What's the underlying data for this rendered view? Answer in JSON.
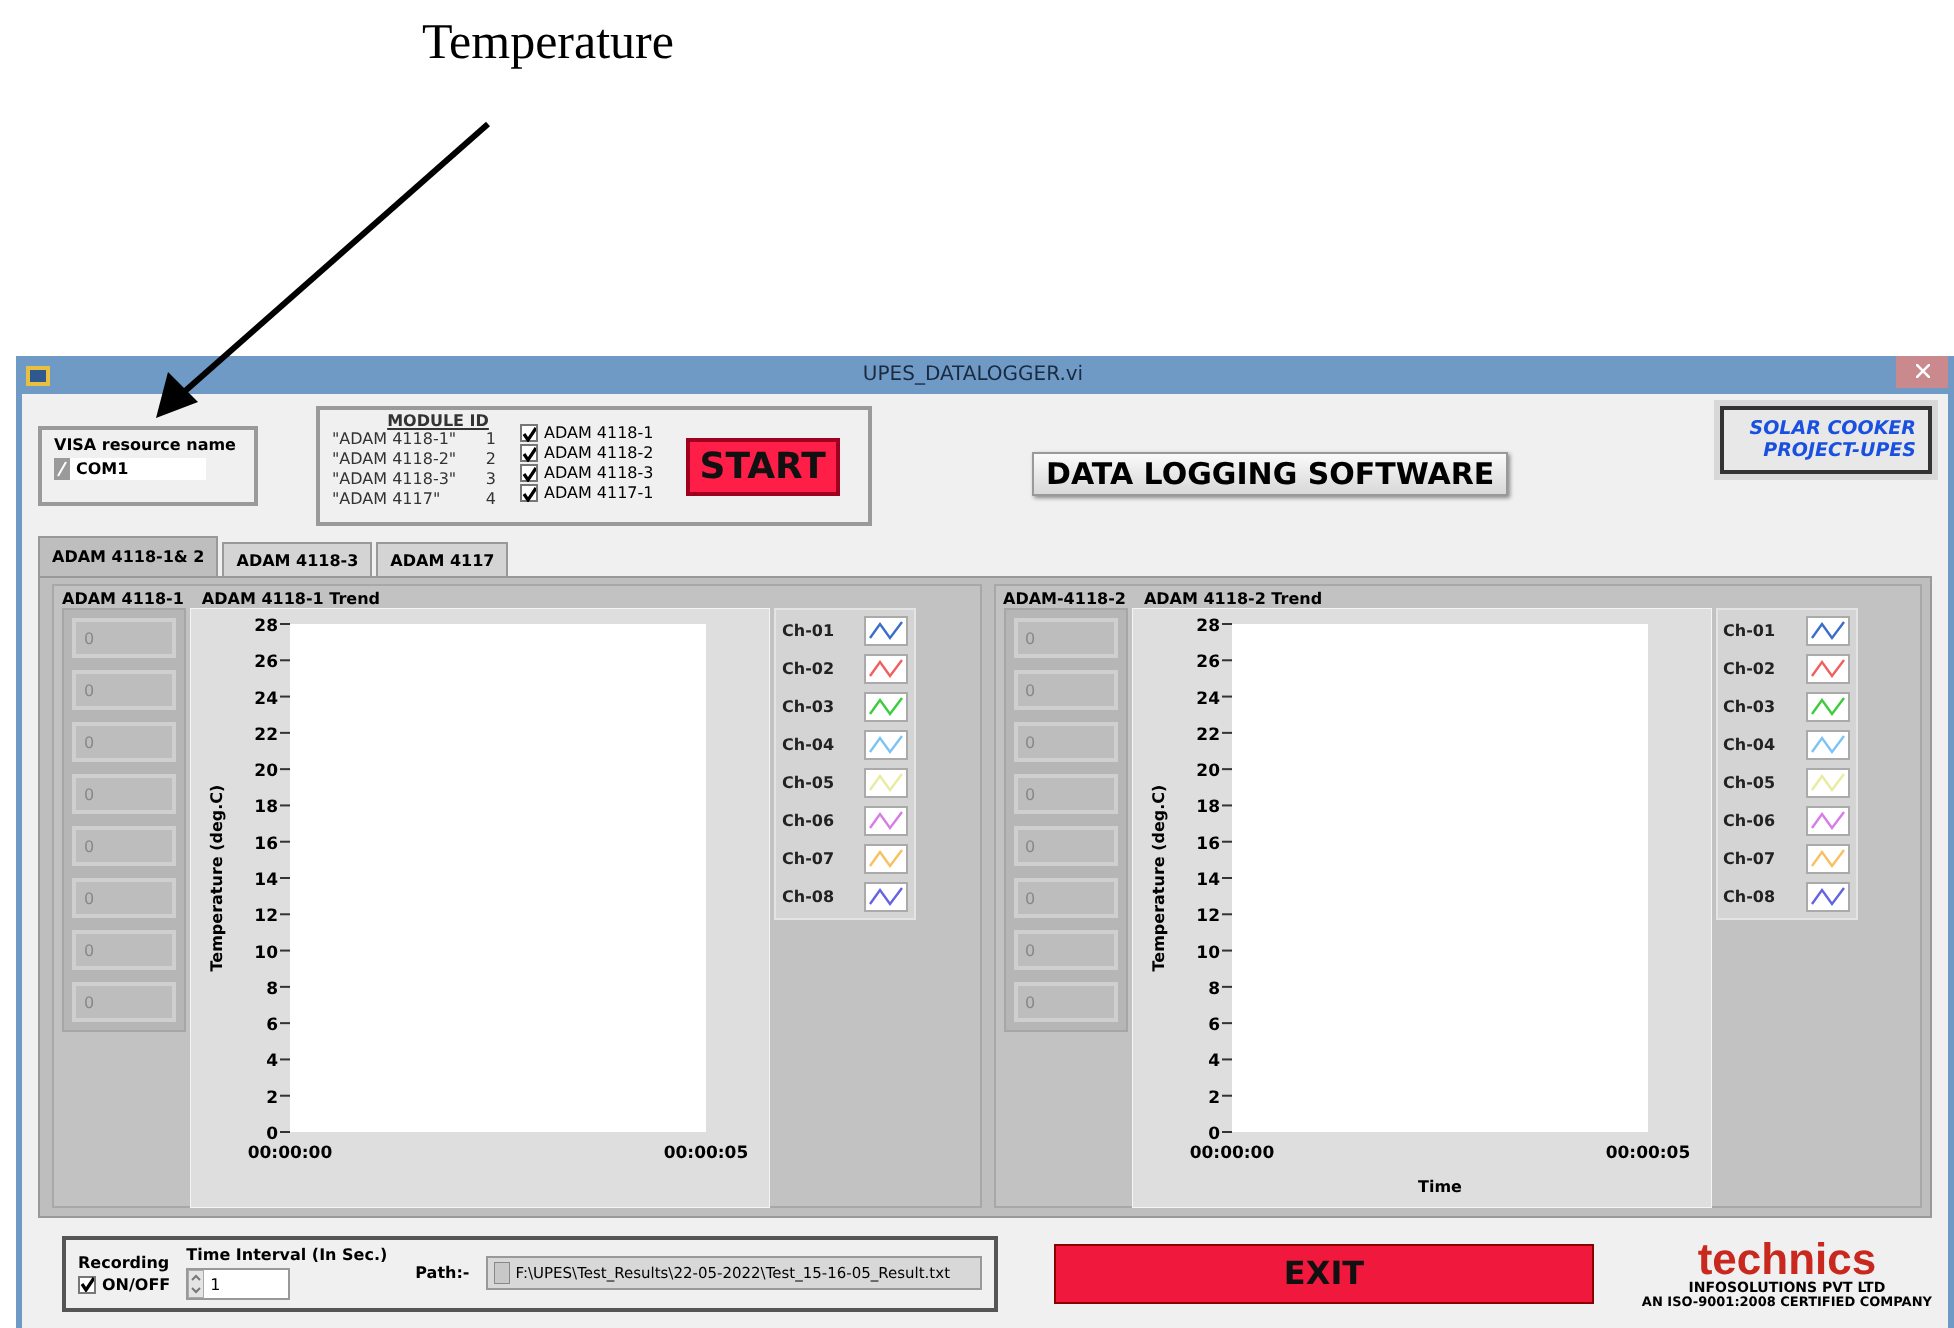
{
  "annotation": {
    "label": "Temperature"
  },
  "window": {
    "title": "UPES_DATALOGGER.vi"
  },
  "visa": {
    "label": "VISA resource name",
    "value": "COM1"
  },
  "module_id": {
    "title": "MODULE ID",
    "rows": [
      {
        "name": "\"ADAM 4118-1\"",
        "number": "1"
      },
      {
        "name": "\"ADAM 4118-2\"",
        "number": "2"
      },
      {
        "name": "\"ADAM 4118-3\"",
        "number": "3"
      },
      {
        "name": "\"ADAM 4117\"",
        "number": "4"
      }
    ],
    "checkboxes": [
      {
        "label": "ADAM 4118-1",
        "checked": true
      },
      {
        "label": "ADAM 4118-2",
        "checked": true
      },
      {
        "label": "ADAM 4118-3",
        "checked": true
      },
      {
        "label": "ADAM 4117-1",
        "checked": true
      }
    ]
  },
  "start_button": "START",
  "banner": "DATA LOGGING SOFTWARE",
  "project": [
    "SOLAR COOKER",
    "PROJECT-UPES"
  ],
  "tabs": [
    {
      "label": "ADAM 4118-1& 2",
      "selected": true
    },
    {
      "label": "ADAM  4118-3",
      "selected": false
    },
    {
      "label": "ADAM  4117",
      "selected": false
    }
  ],
  "panels": [
    {
      "indicator_label": "ADAM 4118-1",
      "trend_title": "ADAM 4118-1 Trend",
      "readings": [
        "0",
        "0",
        "0",
        "0",
        "0",
        "0",
        "0",
        "0"
      ],
      "y_label": "Temperature (deg.C)",
      "y_ticks": [
        "28",
        "26",
        "24",
        "22",
        "20",
        "18",
        "16",
        "14",
        "12",
        "10",
        "8",
        "6",
        "4",
        "2",
        "0"
      ],
      "x_ticks": [
        "00:00:00",
        "00:00:05"
      ],
      "legend": [
        {
          "name": "Ch-01",
          "color": "#3a6ec8"
        },
        {
          "name": "Ch-02",
          "color": "#f06060"
        },
        {
          "name": "Ch-03",
          "color": "#3ccc3c"
        },
        {
          "name": "Ch-04",
          "color": "#7cc4f4"
        },
        {
          "name": "Ch-05",
          "color": "#e8eca0"
        },
        {
          "name": "Ch-06",
          "color": "#d87ce8"
        },
        {
          "name": "Ch-07",
          "color": "#f8c060"
        },
        {
          "name": "Ch-08",
          "color": "#6464e0"
        }
      ]
    },
    {
      "indicator_label": "ADAM-4118-2",
      "trend_title": "ADAM 4118-2 Trend",
      "readings": [
        "0",
        "0",
        "0",
        "0",
        "0",
        "0",
        "0",
        "0"
      ],
      "y_label": "Temperature (deg.C)",
      "y_ticks": [
        "28",
        "26",
        "24",
        "22",
        "20",
        "18",
        "16",
        "14",
        "12",
        "10",
        "8",
        "6",
        "4",
        "2",
        "0"
      ],
      "x_ticks": [
        "00:00:00",
        "00:00:05"
      ],
      "x_label": "Time",
      "legend": [
        {
          "name": "Ch-01",
          "color": "#3a6ec8"
        },
        {
          "name": "Ch-02",
          "color": "#f06060"
        },
        {
          "name": "Ch-03",
          "color": "#3ccc3c"
        },
        {
          "name": "Ch-04",
          "color": "#7cc4f4"
        },
        {
          "name": "Ch-05",
          "color": "#e8eca0"
        },
        {
          "name": "Ch-06",
          "color": "#d87ce8"
        },
        {
          "name": "Ch-07",
          "color": "#f8c060"
        },
        {
          "name": "Ch-08",
          "color": "#6464e0"
        }
      ]
    }
  ],
  "recording": {
    "label": "Recording",
    "toggle_label": "ON/OFF",
    "checked": true
  },
  "time_interval": {
    "label": "Time Interval (In Sec.)",
    "value": "1"
  },
  "path": {
    "label": "Path:-",
    "value": "F:\\UPES\\Test_Results\\22-05-2022\\Test_15-16-05_Result.txt"
  },
  "exit_button": "EXIT",
  "logo": {
    "name": "technics",
    "line1": "INFOSOLUTIONS PVT LTD",
    "line2": "AN ISO-9001:2008 CERTIFIED COMPANY"
  }
}
